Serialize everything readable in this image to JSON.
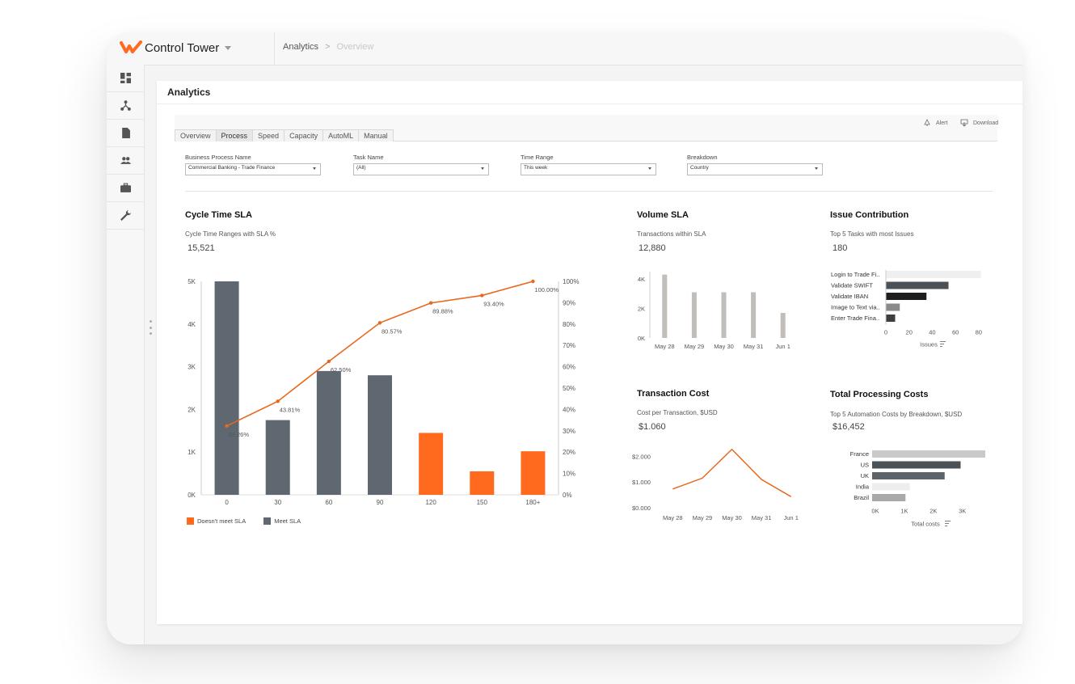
{
  "brand": {
    "name": "Control Tower"
  },
  "breadcrumb": {
    "section": "Analytics",
    "separator": ">",
    "current": "Overview"
  },
  "panel": {
    "title": "Analytics"
  },
  "tabs": [
    "Overview",
    "Process",
    "Speed",
    "Capacity",
    "AutoML",
    "Manual"
  ],
  "active_tab": "Process",
  "toolbar": {
    "alert": "Alert",
    "download": "Download"
  },
  "filters": [
    {
      "label": "Business Process Name",
      "value": "Commercial Banking - Trade Finance"
    },
    {
      "label": "Task Name",
      "value": "(All)"
    },
    {
      "label": "Time Range",
      "value": "This week"
    },
    {
      "label": "Breakdown",
      "value": "Country"
    }
  ],
  "sidebar": [
    "dashboard-icon",
    "network-icon",
    "document-icon",
    "people-icon",
    "briefcase-icon",
    "wrench-icon"
  ],
  "colors": {
    "accent": "#ff6a1f",
    "dark": "#5f6770",
    "gray": "#c0bdbb",
    "line": "#e8681e"
  },
  "cards": {
    "cycle": {
      "title": "Cycle Time SLA",
      "subtitle": "Cycle Time Ranges with SLA %",
      "value": "15,521"
    },
    "volume": {
      "title": "Volume SLA",
      "subtitle": "Transactions within SLA",
      "value": "12,880"
    },
    "issue": {
      "title": "Issue Contribution",
      "subtitle": "Top 5 Tasks with most Issues",
      "value": "180"
    },
    "cost": {
      "title": "Transaction Cost",
      "subtitle": "Cost per Transaction, $USD",
      "value": "$1.060"
    },
    "processing": {
      "title": "Total Processing Costs",
      "subtitle": "Top 5 Automation Costs by Breakdown, $USD",
      "value": "$16,452"
    }
  },
  "legend": {
    "doesnt_meet": "Doesn't meet SLA",
    "meet": "Meet SLA"
  },
  "chart_data": [
    {
      "id": "cycle",
      "type": "bar",
      "categories": [
        "0",
        "30",
        "60",
        "90",
        "120",
        "150",
        "180+"
      ],
      "values": [
        5000,
        1750,
        2900,
        2800,
        1450,
        550,
        1020
      ],
      "meets_sla": [
        true,
        true,
        true,
        true,
        false,
        false,
        false
      ],
      "ylim": [
        0,
        5000
      ],
      "yticks": [
        "0K",
        "1K",
        "2K",
        "3K",
        "4K",
        "5K"
      ],
      "series": [
        {
          "name": "Doesn't meet SLA / Meet SLA",
          "values": [
            5000,
            1750,
            2900,
            2800,
            1450,
            550,
            1020
          ]
        },
        {
          "name": "SLA %",
          "values": [
            32.26,
            43.81,
            62.5,
            80.57,
            89.88,
            93.4,
            100.0
          ],
          "labels": [
            "32.26%",
            "43.81%",
            "62.50%",
            "80.57%",
            "89.88%",
            "93.40%",
            "100.00%"
          ]
        }
      ],
      "y2ticks": [
        "0%",
        "10%",
        "20%",
        "30%",
        "40%",
        "50%",
        "60%",
        "70%",
        "80%",
        "90%",
        "100%"
      ]
    },
    {
      "id": "volume",
      "type": "bar",
      "categories": [
        "May 28",
        "May 29",
        "May 30",
        "May 31",
        "Jun 1"
      ],
      "values": [
        4300,
        3100,
        3100,
        3100,
        1700
      ],
      "ylim": [
        0,
        4500
      ],
      "yticks": [
        "0K",
        "2K",
        "4K"
      ]
    },
    {
      "id": "issue",
      "type": "bar",
      "orientation": "horizontal",
      "categories": [
        "Login to Trade Fi..",
        "Validate SWIFT",
        "Validate IBAN",
        "Image to Text via..",
        "Enter Trade Fina.."
      ],
      "values": [
        82,
        54,
        35,
        12,
        8
      ],
      "xlim": [
        0,
        85
      ],
      "xticks": [
        "0",
        "20",
        "40",
        "60",
        "80"
      ],
      "xlabel": "Issues"
    },
    {
      "id": "cost",
      "type": "line",
      "x": [
        "May 28",
        "May 29",
        "May 30",
        "May 31",
        "Jun 1"
      ],
      "values": [
        730,
        1150,
        2270,
        1100,
        430
      ],
      "ylim": [
        0,
        2200
      ],
      "yticks": [
        "$0.000",
        "$1.000",
        "$2.000"
      ]
    },
    {
      "id": "processing",
      "type": "bar",
      "orientation": "horizontal",
      "categories": [
        "France",
        "US",
        "UK",
        "India",
        "Brazil"
      ],
      "values": [
        3900,
        3050,
        2500,
        1300,
        1150
      ],
      "xlim": [
        0,
        3900
      ],
      "xticks": [
        "0K",
        "1K",
        "2K",
        "3K"
      ],
      "xlabel": "Total costs"
    }
  ]
}
